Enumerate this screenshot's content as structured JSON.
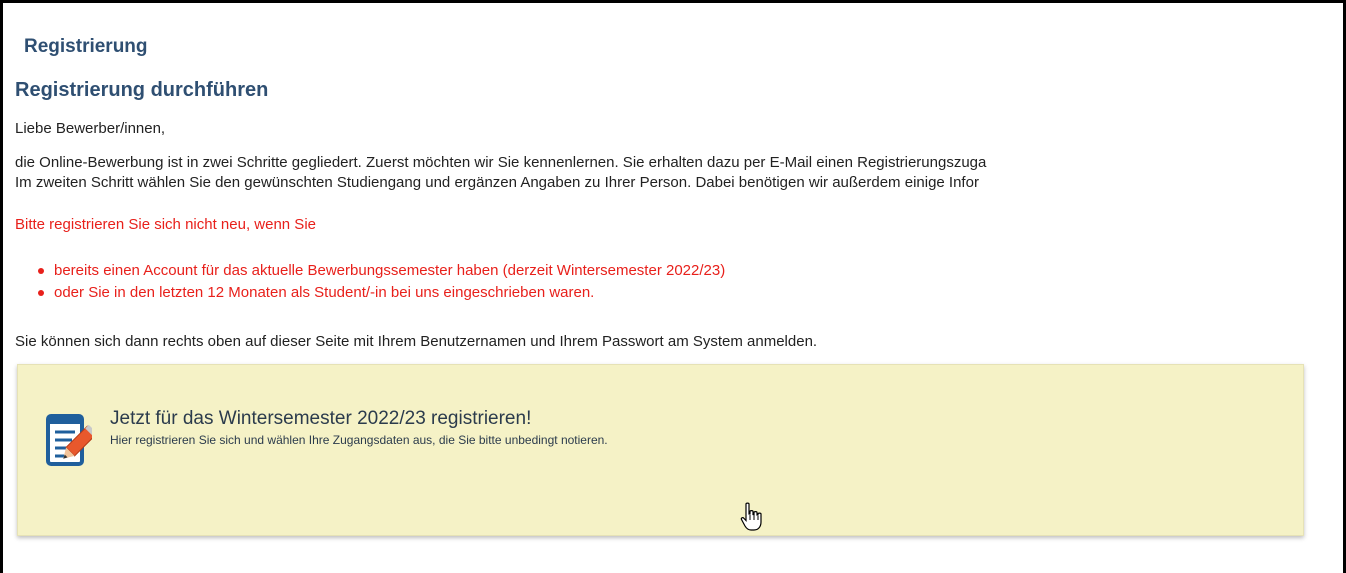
{
  "header": {
    "section_title": "Registrierung",
    "page_heading": "Registrierung durchführen"
  },
  "intro": {
    "greeting": "Liebe Bewerber/innen,",
    "paragraph_line1": "die Online-Bewerbung ist in zwei Schritte gegliedert. Zuerst möchten wir Sie kennenlernen. Sie erhalten dazu per E-Mail einen Registrierungszuga",
    "paragraph_line2": "Im zweiten Schritt wählen Sie den gewünschten Studiengang und ergänzen Angaben zu Ihrer Person. Dabei benötigen wir außerdem einige Infor"
  },
  "warning": {
    "lead": "Bitte registrieren Sie sich nicht neu, wenn Sie",
    "items": [
      "bereits einen Account für das aktuelle Bewerbungssemester haben (derzeit Wintersemester 2022/23)",
      "oder Sie in den letzten 12 Monaten als Student/-in bei uns eingeschrieben waren."
    ],
    "color": "#e8201b"
  },
  "login_note": "Sie können sich dann rechts oben auf dieser Seite mit Ihrem Benutzernamen und Ihrem Passwort am System anmelden.",
  "register_box": {
    "title": "Jetzt für das Wintersemester 2022/23 registrieren!",
    "description": "Hier registrieren Sie sich und wählen Ihre Zugangsdaten aus, die Sie bitte unbedingt notieren.",
    "icon": "register-form-pencil-icon",
    "background": "#f5f2c6"
  },
  "cursor_icon": "hand-pointer-icon",
  "colors": {
    "heading": "#2f4f72",
    "text": "#222222"
  }
}
